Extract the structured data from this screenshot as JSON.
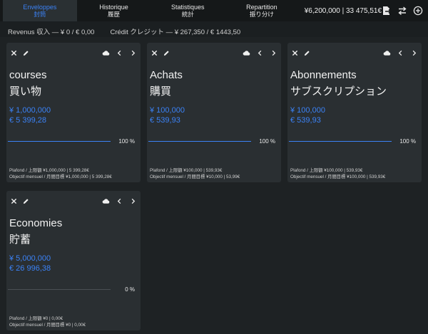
{
  "nav": {
    "tabs": [
      {
        "label": "Enveloppes",
        "sub": "封筒"
      },
      {
        "label": "Historique",
        "sub": "履歴"
      },
      {
        "label": "Statistiques",
        "sub": "統計"
      },
      {
        "label": "Repartition",
        "sub": "振り分け"
      }
    ],
    "active_tab": 0,
    "totals": "¥6,200,000 | 33 475,51€",
    "icons": [
      "export-icon",
      "transfer-icon",
      "add-circle-icon"
    ]
  },
  "summary": {
    "revenue": "Revenus 収入 — ¥ 0 / € 0,00",
    "credit": "Crédit クレジット — ¥ 267,350 / € 1443,50"
  },
  "colors": {
    "accent": "#3b82f6",
    "card": "#2a2f32",
    "background": "#1e2224"
  },
  "envelopes": [
    {
      "name": "courses",
      "name_jp": "買い物",
      "amount_jpy": "¥ 1,000,000",
      "amount_eur": "€ 5 399,28",
      "progress": 100,
      "progress_label": "100 %",
      "plafond": "Plafond / 上限額  ¥1,000,000 | 5 399,28€",
      "objectif": "Objectif mensuel / 月間目標  ¥1,000,000 | 5 399,28€"
    },
    {
      "name": "Achats",
      "name_jp": "購買",
      "amount_jpy": "¥ 100,000",
      "amount_eur": "€ 539,93",
      "progress": 100,
      "progress_label": "100 %",
      "plafond": "Plafond / 上限額  ¥100,000 | 539,93€",
      "objectif": "Objectif mensuel / 月間目標  ¥10,000 | 53,99€"
    },
    {
      "name": "Abonnements",
      "name_jp": "サブスクリプション",
      "amount_jpy": "¥ 100,000",
      "amount_eur": "€ 539,93",
      "progress": 100,
      "progress_label": "100 %",
      "plafond": "Plafond / 上限額  ¥100,000 | 539,93€",
      "objectif": "Objectif mensuel / 月間目標  ¥100,000 | 539,93€"
    },
    {
      "name": "Economies",
      "name_jp": "貯蓄",
      "amount_jpy": "¥ 5,000,000",
      "amount_eur": "€ 26 996,38",
      "progress": 0,
      "progress_label": "0 %",
      "plafond": "Plafond / 上限額  ¥0 | 0,00€",
      "objectif": "Objectif mensuel / 月間目標  ¥0 | 0,00€"
    }
  ]
}
